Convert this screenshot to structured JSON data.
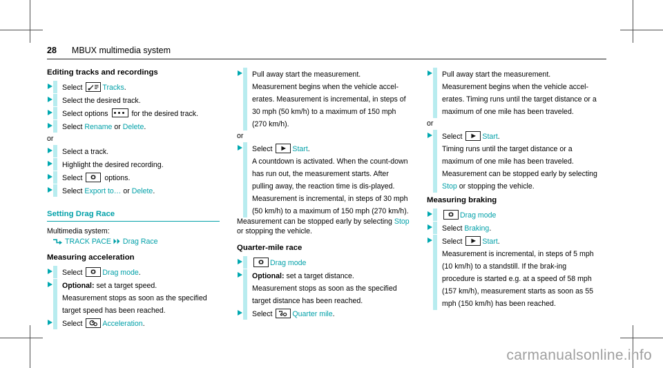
{
  "header": {
    "page_number": "28",
    "title": "MBUX multimedia system"
  },
  "watermark": "carmanualsonline.info",
  "colors": {
    "accent_teal": "#00a0a8",
    "bullet_teal": "#00a8b0",
    "bar_cyan": "#b8ecef",
    "text": "#000000",
    "watermark_gray": "#9f9f9f"
  },
  "column_left": {
    "section1": {
      "heading": "Editing tracks and recordings",
      "steps": [
        {
          "pre": "Select ",
          "icon": "tracks-icon",
          "link": "Tracks",
          "post": "."
        },
        {
          "pre": "Select the desired track.",
          "icon": "",
          "link": "",
          "post": ""
        },
        {
          "pre": "Select options ",
          "icon": "ellipsis-icon",
          "link": "",
          "post": " for the desired track."
        },
        {
          "pre": "Select ",
          "icon": "",
          "link": "Rename",
          "mid": " or ",
          "link2": "Delete",
          "post": "."
        }
      ],
      "or_label": "or",
      "steps2": [
        {
          "pre": "Select a track.",
          "icon": "",
          "link": "",
          "post": ""
        },
        {
          "pre": "Highlight the desired recording.",
          "icon": "",
          "link": "",
          "post": ""
        },
        {
          "pre": "Select ",
          "icon": "gear-icon",
          "link": "",
          "post": " options."
        },
        {
          "pre": "Select ",
          "icon": "",
          "link": "Export to…",
          "mid": " or ",
          "link2": "Delete",
          "post": "."
        }
      ]
    },
    "section2": {
      "heading": "Setting Drag Race",
      "intro": "Multimedia system:",
      "breadcrumb": {
        "root": "TRACK PACE",
        "leaf": "Drag Race"
      },
      "sub_heading": "Measuring acceleration",
      "steps": [
        {
          "pre": "Select ",
          "icon": "gear-icon",
          "link": "Drag mode",
          "post": "."
        },
        {
          "bold": "Optional:",
          "pre": " set a target speed.",
          "line2": "Measurement stops as soon as the specified target speed has been reached."
        },
        {
          "pre": "Select ",
          "icon": "acceleration-icon",
          "link": "Acceleration",
          "post": "."
        }
      ]
    }
  },
  "column_middle": {
    "steps": [
      {
        "pre": "Pull away start the measurement.",
        "body": "Measurement begins when the vehicle accel-erates. Measurement is incremental, in steps of 30 mph (50 km/h) to a maximum of 150 mph (270 km/h)."
      }
    ],
    "or_label": "or",
    "steps2": [
      {
        "pre": "Select ",
        "icon": "play-icon",
        "link": "Start",
        "post": ".",
        "body": "A countdown is activated. When the count-down has run out, the measurement starts. After pulling away, the reaction time is dis-played. Measurement is incremental, in steps of 30 mph (50 km/h) to a maximum of 150 mph (270 km/h)."
      }
    ],
    "closing": {
      "line1": "Measurement can be stopped early by selecting ",
      "link": "Stop",
      "line2": " or stopping the vehicle."
    },
    "section": {
      "heading": "Quarter-mile race",
      "steps": [
        {
          "pre": "",
          "icon": "gear-icon",
          "link": "Drag mode",
          "post": ""
        },
        {
          "bold": "Optional:",
          "pre": " set a target distance.",
          "line2": "Measurement stops as soon as the specified target distance has been reached."
        },
        {
          "pre": "Select ",
          "icon": "quarter-mile-icon",
          "link": "Quarter mile",
          "post": "."
        }
      ]
    }
  },
  "column_right": {
    "steps": [
      {
        "pre": "Pull away start the measurement.",
        "body": "Measurement begins when the vehicle accel-erates. Timing runs until the target distance or a maximum of one mile has been traveled."
      }
    ],
    "or_label": "or",
    "steps2": [
      {
        "pre": "Select ",
        "icon": "play-icon",
        "link": "Start",
        "post": ".",
        "body": "Timing runs until the target distance or a maximum of one mile has been traveled.",
        "body2_pre": "Measurement can be stopped early by selecting ",
        "body2_link": "Stop",
        "body2_post": " or stopping the vehicle."
      }
    ],
    "section": {
      "heading": "Measuring braking",
      "steps": [
        {
          "pre": "",
          "icon": "gear-icon",
          "link": "Drag mode",
          "post": ""
        },
        {
          "pre": "Select ",
          "icon": "",
          "link": "Braking",
          "post": "."
        },
        {
          "pre": "Select ",
          "icon": "play-icon",
          "link": "Start",
          "post": ".",
          "body": "Measurement is incremental, in steps of 5 mph (10 km/h) to a standstill. If the brak-ing procedure is started e.g. at a speed of 58 mph (157 km/h), measurement starts as soon as 55 mph (150 km/h) has been reached."
        }
      ]
    }
  }
}
